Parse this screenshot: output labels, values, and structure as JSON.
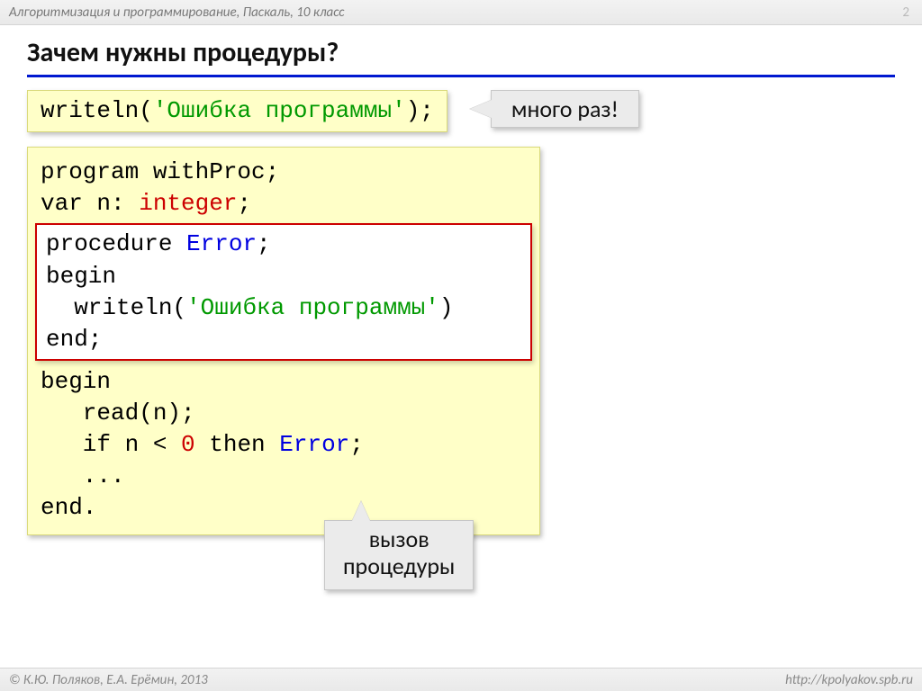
{
  "header": {
    "subject": "Алгоритмизация и программирование, Паскаль, 10 класс",
    "page_number": "2"
  },
  "title": "Зачем нужны процедуры?",
  "snippet1": {
    "func": "writeln",
    "open": "(",
    "str": "'Ошибка программы'",
    "close": ");"
  },
  "callout_right": "много раз!",
  "program": {
    "line1a": "program withProc;",
    "line2a": "var n: ",
    "line2b": "integer",
    "line2c": ";",
    "proc_l1a": "procedure ",
    "proc_l1b": "Error",
    "proc_l1c": ";",
    "proc_l2": "begin",
    "proc_l3a": "  writeln(",
    "proc_l3b": "'Ошибка программы'",
    "proc_l3c": ")",
    "proc_l4": "end;",
    "body_l1": "begin",
    "body_l2": "   read(n);",
    "body_l3a": "   if n < ",
    "body_l3b": "0",
    "body_l3c": " then ",
    "body_l3d": "Error",
    "body_l3e": ";",
    "body_l4": "   ...",
    "body_l5": "end."
  },
  "callout_bottom_l1": "вызов",
  "callout_bottom_l2": "процедуры",
  "footer": {
    "copyright": "© К.Ю. Поляков, Е.А. Ерёмин, 2013",
    "url": "http://kpolyakov.spb.ru"
  }
}
